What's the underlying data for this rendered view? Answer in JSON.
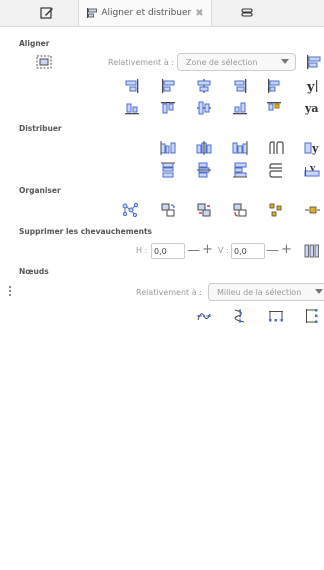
{
  "tabs": [
    {
      "icon": "edit-icon",
      "label": ""
    },
    {
      "icon": "align-distribute-icon",
      "label": "Aligner et distribuer",
      "close": "✖"
    },
    {
      "icon": "stack-icon",
      "label": ""
    }
  ],
  "sections": {
    "aligner": "Aligner",
    "distribuer": "Distribuer",
    "organiser": "Organiser",
    "chevauchements": "Supprimer les chevauchements",
    "noeuds": "Nœuds"
  },
  "aligner": {
    "relative_label": "Relativement à :",
    "relative_value": "Zone de sélection"
  },
  "overlap": {
    "h_label": "H :",
    "h_value": "0,0",
    "v_label": "V :",
    "v_value": "0,0",
    "minus": "—",
    "plus": "+"
  },
  "noeuds": {
    "relative_label": "Relativement à :",
    "relative_value": "Milieu de la sélection"
  },
  "colors": {
    "accent": "#4a6fd0",
    "accent_fill": "#c9d6f5",
    "danger": "#d03030",
    "warn": "#e0b020",
    "ink": "#4a4a4a"
  }
}
